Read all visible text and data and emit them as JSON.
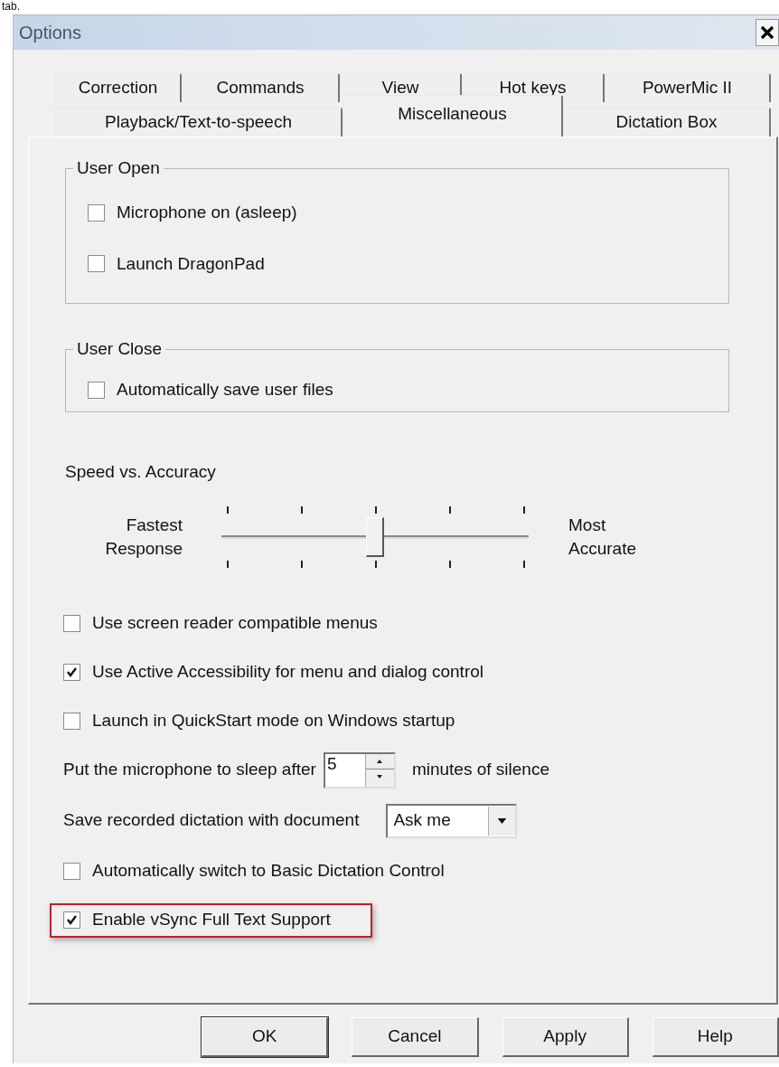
{
  "caption": "tab.",
  "window": {
    "title": "Options"
  },
  "tab_rows": [
    {
      "tabs": [
        {
          "label": "Correction",
          "selected": false
        },
        {
          "label": "Commands",
          "selected": false
        },
        {
          "label": "View",
          "selected": false
        },
        {
          "label": "Hot keys",
          "selected": false
        },
        {
          "label": "PowerMic II",
          "selected": false
        }
      ]
    },
    {
      "tabs": [
        {
          "label": "Playback/Text-to-speech",
          "selected": false
        },
        {
          "label": "Miscellaneous",
          "selected": true
        },
        {
          "label": "Dictation Box",
          "selected": false
        }
      ]
    }
  ],
  "groups": [
    {
      "title": "User Open",
      "options": [
        {
          "label": "Microphone on (asleep)",
          "checked": false
        },
        {
          "label": "Launch DragonPad",
          "checked": false
        }
      ]
    },
    {
      "title": "User Close",
      "options": [
        {
          "label": "Automatically save user files",
          "checked": false
        }
      ]
    }
  ],
  "speed_accuracy": {
    "label": "Speed vs. Accuracy",
    "left_label": "Fastest Response",
    "right_label": "Most Accurate",
    "level": 0.5
  },
  "settings": [
    {
      "kind": "checkbox",
      "label": "Use screen reader compatible menus",
      "checked": false,
      "highlighted": false
    },
    {
      "kind": "checkbox",
      "label": "Use Active Accessibility for menu and dialog control",
      "checked": true,
      "highlighted": false
    },
    {
      "kind": "checkbox",
      "label": "Launch in QuickStart mode on Windows startup",
      "checked": false,
      "highlighted": false
    },
    {
      "kind": "spin",
      "label": "Put the microphone to sleep after",
      "value": "5",
      "suffix": "minutes of silence"
    },
    {
      "kind": "dropdown",
      "label": "Save recorded dictation with document",
      "value": "Ask me"
    },
    {
      "kind": "checkbox",
      "label": "Automatically switch to Basic Dictation Control",
      "checked": false,
      "highlighted": false
    },
    {
      "kind": "checkbox",
      "label": "Enable vSync Full Text Support",
      "checked": true,
      "highlighted": true
    }
  ],
  "buttons": [
    {
      "label": "OK",
      "default": true
    },
    {
      "label": "Cancel",
      "default": false
    },
    {
      "label": "Apply",
      "default": false
    },
    {
      "label": "Help",
      "default": false
    }
  ]
}
